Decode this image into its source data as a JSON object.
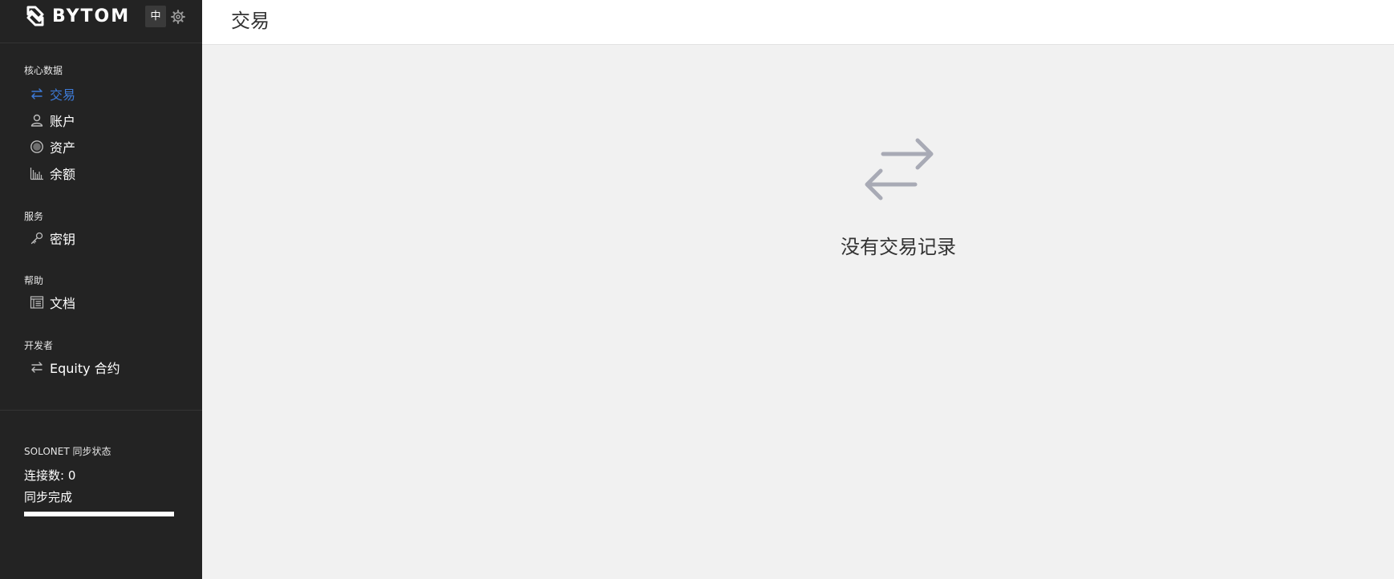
{
  "brand": {
    "name": "BYTOM"
  },
  "header": {
    "language_label": "中",
    "page_title": "交易"
  },
  "sidebar": {
    "sections": [
      {
        "title": "核心数据",
        "items": [
          {
            "label": "交易",
            "icon": "transfer-arrows-icon",
            "active": true
          },
          {
            "label": "账户",
            "icon": "user-icon"
          },
          {
            "label": "资产",
            "icon": "asset-circle-icon"
          },
          {
            "label": "余额",
            "icon": "bar-chart-icon"
          }
        ]
      },
      {
        "title": "服务",
        "items": [
          {
            "label": "密钥",
            "icon": "key-icon"
          }
        ]
      },
      {
        "title": "帮助",
        "items": [
          {
            "label": "文档",
            "icon": "document-icon"
          }
        ]
      },
      {
        "title": "开发者",
        "items": [
          {
            "label": "Equity 合约",
            "icon": "transfer-arrows-icon"
          }
        ]
      }
    ]
  },
  "sync": {
    "title": "SOLONET 同步状态",
    "connections": "连接数: 0",
    "status": "同步完成",
    "progress_percent": 100
  },
  "main": {
    "empty_message": "没有交易记录"
  },
  "colors": {
    "sidebar_bg": "#232323",
    "active": "#3d7ad6",
    "main_bg": "#f1f1f1",
    "empty_icon": "#a8aab5"
  }
}
